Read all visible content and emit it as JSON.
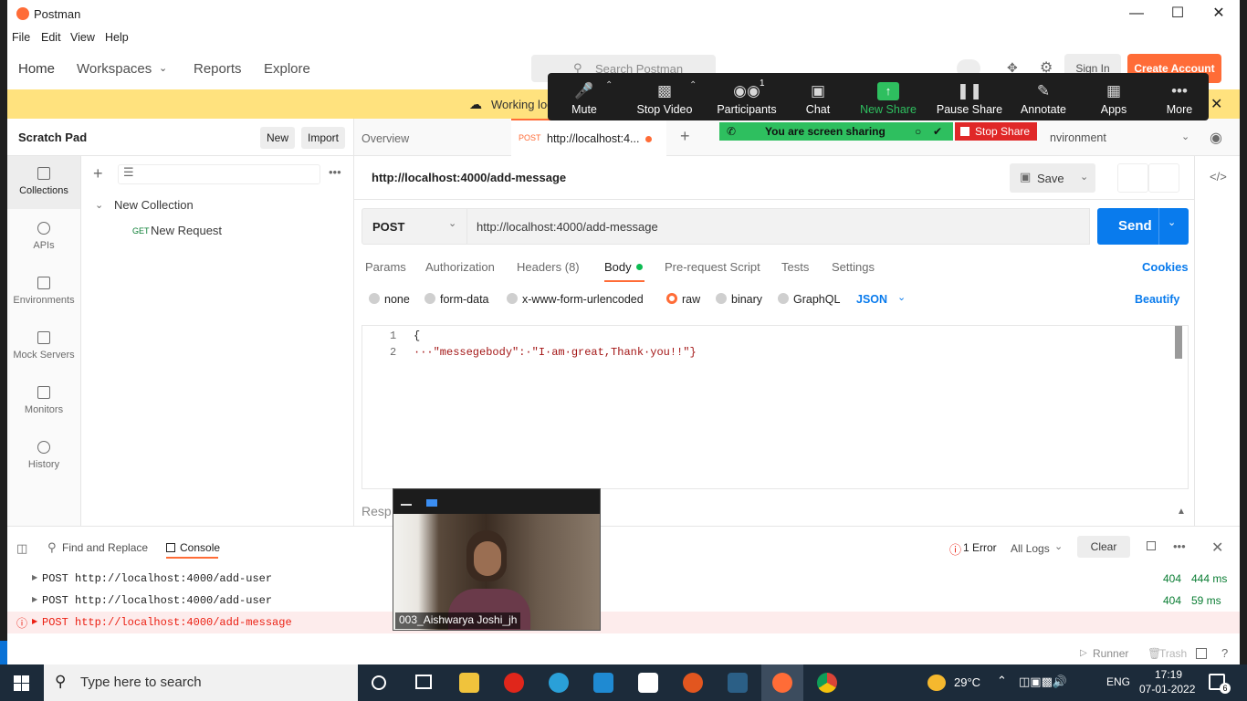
{
  "window": {
    "title": "Postman"
  },
  "menu": [
    "File",
    "Edit",
    "View",
    "Help"
  ],
  "nav": {
    "home": "Home",
    "workspaces": "Workspaces",
    "reports": "Reports",
    "explore": "Explore",
    "search_placeholder": "Search Postman",
    "sign_in": "Sign In",
    "create_account": "Create Account"
  },
  "banner": {
    "text": "Working loc"
  },
  "scratch_pad": {
    "title": "Scratch Pad",
    "new": "New",
    "import": "Import"
  },
  "sidebar": [
    {
      "label": "Collections",
      "icon": "collections-icon"
    },
    {
      "label": "APIs",
      "icon": "apis-icon"
    },
    {
      "label": "Environments",
      "icon": "environments-icon"
    },
    {
      "label": "Mock Servers",
      "icon": "mock-servers-icon"
    },
    {
      "label": "Monitors",
      "icon": "monitors-icon"
    },
    {
      "label": "History",
      "icon": "history-icon"
    }
  ],
  "collections": {
    "collection_name": "New Collection",
    "request_method": "GET",
    "request_name": "New Request"
  },
  "tabs": {
    "overview": "Overview",
    "active_method": "POST",
    "active_label": "http://localhost:4...",
    "environment": "nvironment"
  },
  "request": {
    "title": "http://localhost:4000/add-message",
    "save": "Save",
    "method": "POST",
    "url": "http://localhost:4000/add-message",
    "send": "Send",
    "subtabs": {
      "params": "Params",
      "authorization": "Authorization",
      "headers": "Headers (8)",
      "body": "Body",
      "prescript": "Pre-request Script",
      "tests": "Tests",
      "settings": "Settings",
      "cookies": "Cookies"
    },
    "body_options": {
      "none": "none",
      "form_data": "form-data",
      "urlencoded": "x-www-form-urlencoded",
      "raw": "raw",
      "binary": "binary",
      "graphql": "GraphQL",
      "format": "JSON",
      "beautify": "Beautify"
    },
    "editor_lines": [
      {
        "num": "1",
        "text": "{"
      },
      {
        "num": "2",
        "text": "···\"messegebody\":·\"I·am·great,Thank·you!!\"}"
      }
    ],
    "response_label": "Resp"
  },
  "console": {
    "find_replace": "Find and Replace",
    "console": "Console",
    "errors": "1 Error",
    "all_logs": "All Logs",
    "clear": "Clear",
    "rows": [
      {
        "text": "POST http://localhost:4000/add-user",
        "status": "404",
        "time": "444 ms",
        "error": false
      },
      {
        "text": "POST http://localhost:4000/add-user",
        "status": "404",
        "time": "59 ms",
        "error": false
      },
      {
        "text": "POST http://localhost:4000/add-message",
        "status": "",
        "time": "",
        "error": true
      }
    ],
    "runner": "Runner",
    "trash": "Trash"
  },
  "zoom": {
    "buttons": [
      {
        "label": "Mute",
        "icon": "microphone-icon"
      },
      {
        "label": "Stop Video",
        "icon": "video-camera-icon"
      },
      {
        "label": "Participants",
        "icon": "participants-icon",
        "badge": "1"
      },
      {
        "label": "Chat",
        "icon": "chat-icon"
      },
      {
        "label": "New Share",
        "icon": "share-screen-icon"
      },
      {
        "label": "Pause Share",
        "icon": "pause-icon"
      },
      {
        "label": "Annotate",
        "icon": "pencil-icon"
      },
      {
        "label": "Apps",
        "icon": "apps-icon"
      },
      {
        "label": "More",
        "icon": "more-icon"
      }
    ],
    "sharing": "You are screen sharing",
    "stop_share": "Stop Share"
  },
  "video": {
    "name": "003_Aishwarya Joshi_jh"
  },
  "taskbar": {
    "search": "Type here to search",
    "weather": "29°C",
    "lang": "ENG",
    "time": "17:19",
    "date": "07-01-2022",
    "notifications": "6"
  },
  "colors": {
    "accent": "#ff6c37",
    "send": "#097bed",
    "banner": "#ffe27e",
    "zoom_green": "#2ebf5f"
  }
}
